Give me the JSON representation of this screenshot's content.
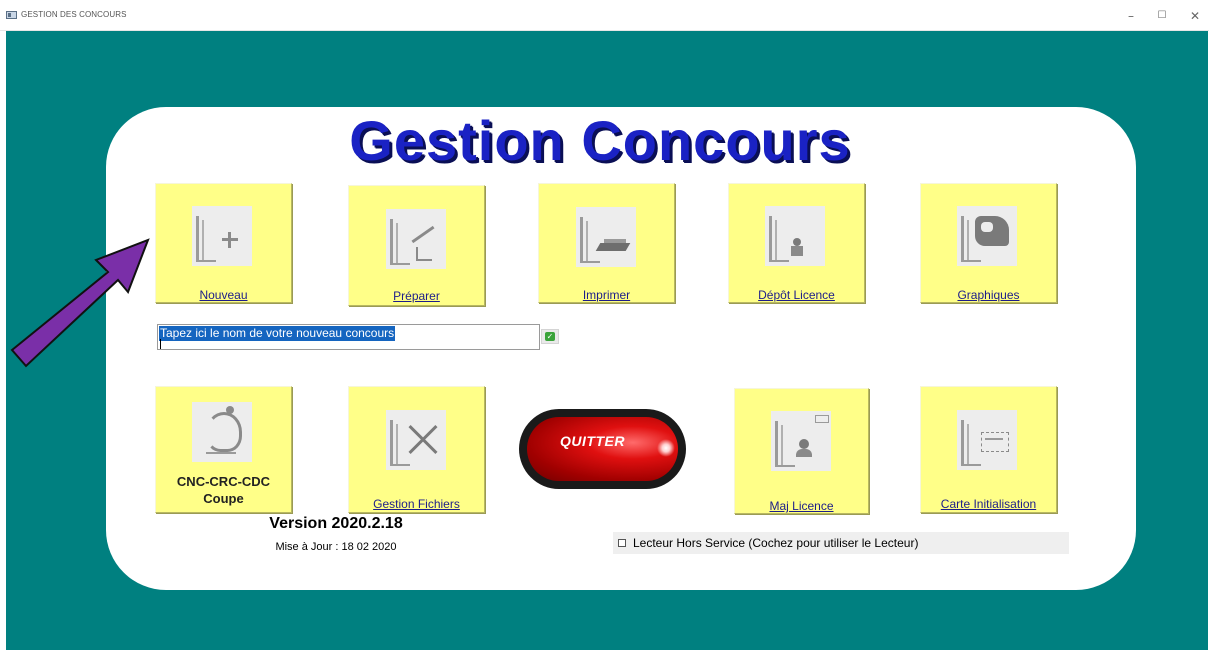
{
  "window": {
    "title": "GESTION DES CONCOURS",
    "minimize": "–",
    "maximize": "☐",
    "close": "✕"
  },
  "header": {
    "title": "Gestion Concours"
  },
  "tiles_top": [
    {
      "label": "Nouveau",
      "icon": "new-contest-icon"
    },
    {
      "label": "Préparer",
      "icon": "prepare-icon"
    },
    {
      "label": "Imprimer",
      "icon": "print-icon"
    },
    {
      "label": "Dépôt Licence",
      "icon": "license-deposit-icon"
    },
    {
      "label": "Graphiques",
      "icon": "charts-icon"
    }
  ],
  "tiles_bottom": [
    {
      "label_line1": "CNC-CRC-CDC",
      "label_line2": "Coupe",
      "icon": "rooster-icon"
    },
    {
      "label": "Gestion Fichiers",
      "icon": "tools-icon"
    },
    {
      "label": "Maj Licence",
      "icon": "license-update-icon"
    },
    {
      "label": "Carte Initialisation",
      "icon": "card-init-icon"
    }
  ],
  "name_input": {
    "value": "Tapez ici le nom de votre nouveau concours"
  },
  "quit_button": {
    "label": "QUITTER"
  },
  "footer": {
    "version": "Version 2020.2.18",
    "updated": "Mise à Jour : 18 02 2020"
  },
  "reader_checkbox": {
    "label": "Lecteur Hors Service (Cochez pour utiliser le Lecteur)",
    "checked": false
  },
  "colors": {
    "background": "#008080",
    "tile": "#ffff88",
    "title": "#1a22c4",
    "annotation_arrow": "#7a2fa8"
  }
}
